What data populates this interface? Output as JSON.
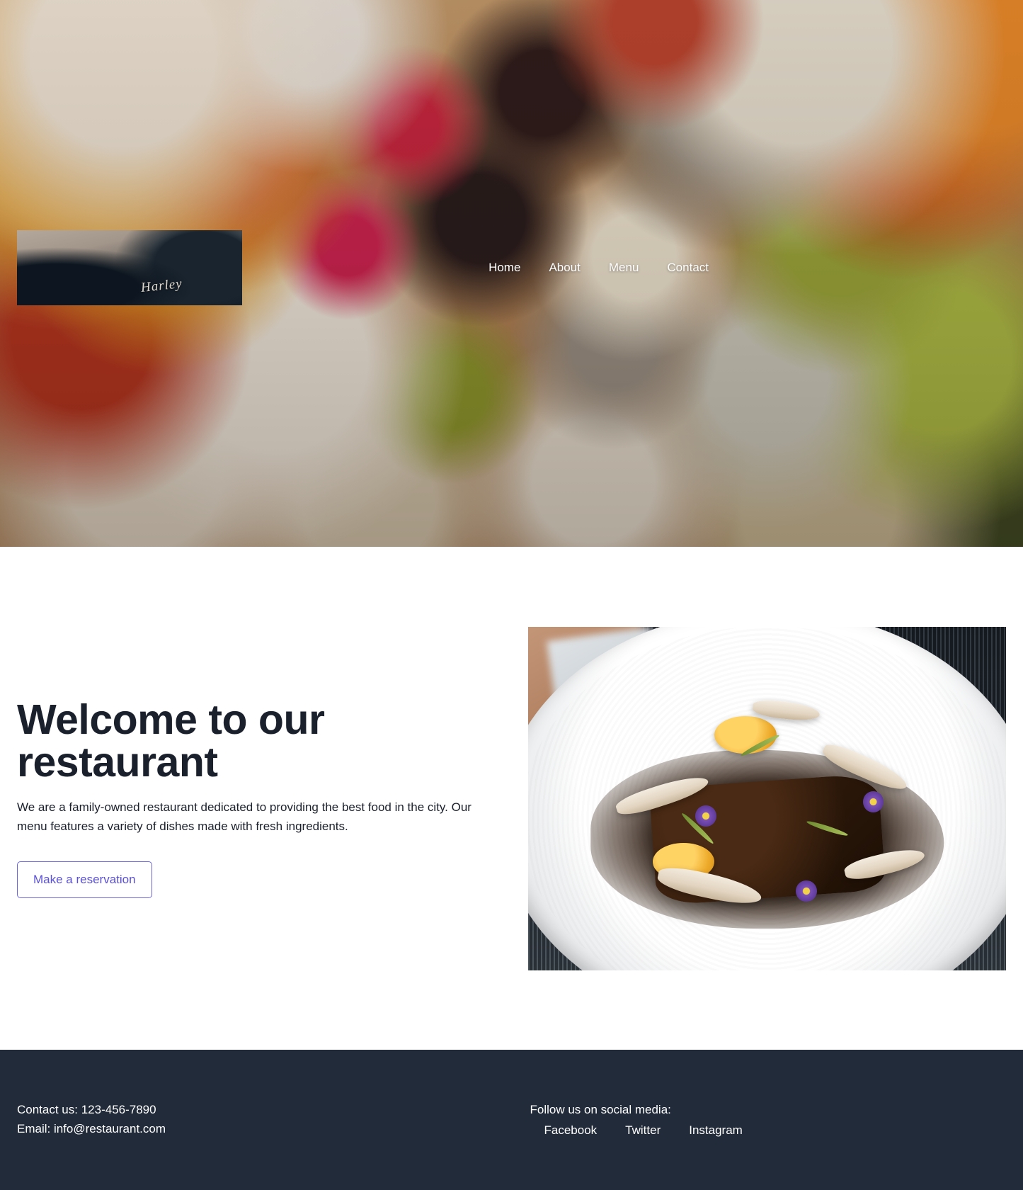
{
  "header": {
    "logo_alt": "Restaurant logo",
    "logo_script_text": "Harley",
    "nav": [
      {
        "label": "Home"
      },
      {
        "label": "About"
      },
      {
        "label": "Menu"
      },
      {
        "label": "Contact"
      }
    ]
  },
  "main": {
    "title": "Welcome to our restaurant",
    "paragraph": "We are a family-owned restaurant dedicated to providing the best food in the city. Our menu features a variety of dishes made with fresh ingredients.",
    "cta_label": "Make a reservation",
    "dish_image_alt": "Plated gourmet dish"
  },
  "footer": {
    "contact_line": "Contact us: 123-456-7890",
    "email_line": "Email: info@restaurant.com",
    "social_heading": "Follow us on social media:",
    "social": [
      {
        "label": "Facebook"
      },
      {
        "label": "Twitter"
      },
      {
        "label": "Instagram"
      }
    ]
  },
  "colors": {
    "footer_background": "#222b3a",
    "cta_accent": "#5a51d6",
    "cta_border": "#6b63d8",
    "heading": "#1a202c",
    "page_background": "#ffffff"
  }
}
